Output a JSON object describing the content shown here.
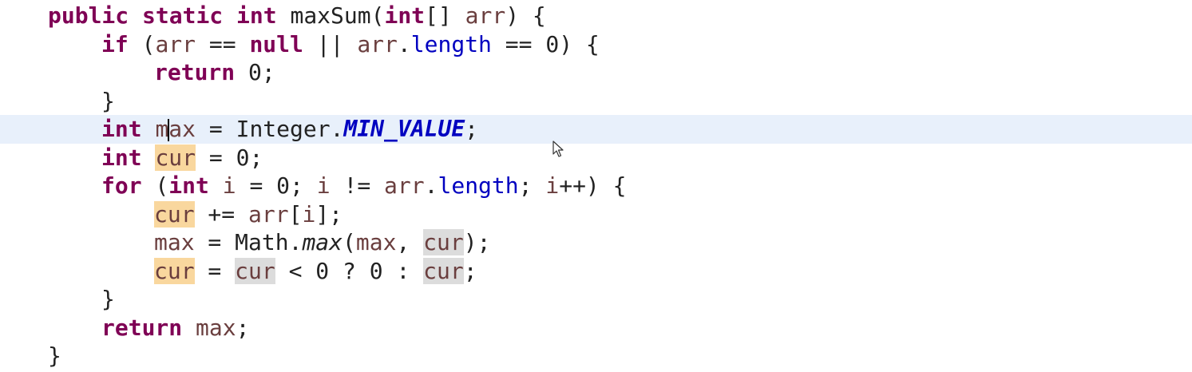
{
  "editor": {
    "language": "java",
    "colors": {
      "keyword": "#7f0055",
      "field": "#0000c0",
      "current_line_highlight": "#e8f0fb",
      "write_occurrence_highlight": "#f9d79e",
      "read_occurrence_highlight": "#dcdcdc",
      "background": "#ffffff"
    },
    "lines": [
      [
        {
          "text": "public",
          "cls": "kw"
        },
        {
          "text": " "
        },
        {
          "text": "static",
          "cls": "kw"
        },
        {
          "text": " "
        },
        {
          "text": "int",
          "cls": "kw"
        },
        {
          "text": " maxSum("
        },
        {
          "text": "int",
          "cls": "kw"
        },
        {
          "text": "[] "
        },
        {
          "text": "arr",
          "cls": "var"
        },
        {
          "text": ") {"
        }
      ],
      [
        {
          "text": "if",
          "cls": "kw"
        },
        {
          "text": " ("
        },
        {
          "text": "arr",
          "cls": "var"
        },
        {
          "text": " == "
        },
        {
          "text": "null",
          "cls": "kw"
        },
        {
          "text": " || "
        },
        {
          "text": "arr",
          "cls": "var"
        },
        {
          "text": "."
        },
        {
          "text": "length",
          "cls": "fld"
        },
        {
          "text": " == 0) {"
        }
      ],
      [
        {
          "text": "return",
          "cls": "kw"
        },
        {
          "text": " 0;"
        }
      ],
      [
        {
          "text": "}"
        }
      ],
      [
        {
          "text": "int",
          "cls": "kw"
        },
        {
          "text": " "
        },
        {
          "text": "m",
          "cls": "var"
        },
        {
          "caret": true
        },
        {
          "text": "ax",
          "cls": "var"
        },
        {
          "text": " = Integer."
        },
        {
          "text": "MIN_VALUE",
          "cls": "sfld"
        },
        {
          "text": ";"
        }
      ],
      [
        {
          "text": "int",
          "cls": "kw"
        },
        {
          "text": " "
        },
        {
          "text": "cur",
          "cls": "var hl-write"
        },
        {
          "text": " = 0;"
        }
      ],
      [
        {
          "text": "for",
          "cls": "kw"
        },
        {
          "text": " ("
        },
        {
          "text": "int",
          "cls": "kw"
        },
        {
          "text": " "
        },
        {
          "text": "i",
          "cls": "var"
        },
        {
          "text": " = 0; "
        },
        {
          "text": "i",
          "cls": "var"
        },
        {
          "text": " != "
        },
        {
          "text": "arr",
          "cls": "var"
        },
        {
          "text": "."
        },
        {
          "text": "length",
          "cls": "fld"
        },
        {
          "text": "; "
        },
        {
          "text": "i",
          "cls": "var"
        },
        {
          "text": "++) {"
        }
      ],
      [
        {
          "text": "cur",
          "cls": "var hl-write"
        },
        {
          "text": " += "
        },
        {
          "text": "arr",
          "cls": "var"
        },
        {
          "text": "["
        },
        {
          "text": "i",
          "cls": "var"
        },
        {
          "text": "];"
        }
      ],
      [
        {
          "text": "max",
          "cls": "var"
        },
        {
          "text": " = Math."
        },
        {
          "text": "max",
          "cls": "smeth"
        },
        {
          "text": "("
        },
        {
          "text": "max",
          "cls": "var"
        },
        {
          "text": ", "
        },
        {
          "text": "cur",
          "cls": "var hl-read"
        },
        {
          "text": ");"
        }
      ],
      [
        {
          "text": "cur",
          "cls": "var hl-write"
        },
        {
          "text": " = "
        },
        {
          "text": "cur",
          "cls": "var hl-read"
        },
        {
          "text": " < 0 ? 0 : "
        },
        {
          "text": "cur",
          "cls": "var hl-read"
        },
        {
          "text": ";"
        }
      ],
      [
        {
          "text": "}"
        }
      ],
      [
        {
          "text": "return",
          "cls": "kw"
        },
        {
          "text": " "
        },
        {
          "text": "max",
          "cls": "var"
        },
        {
          "text": ";"
        }
      ],
      [
        {
          "text": "}"
        }
      ]
    ]
  },
  "cursor": {
    "icon": "mouse-pointer-icon"
  }
}
